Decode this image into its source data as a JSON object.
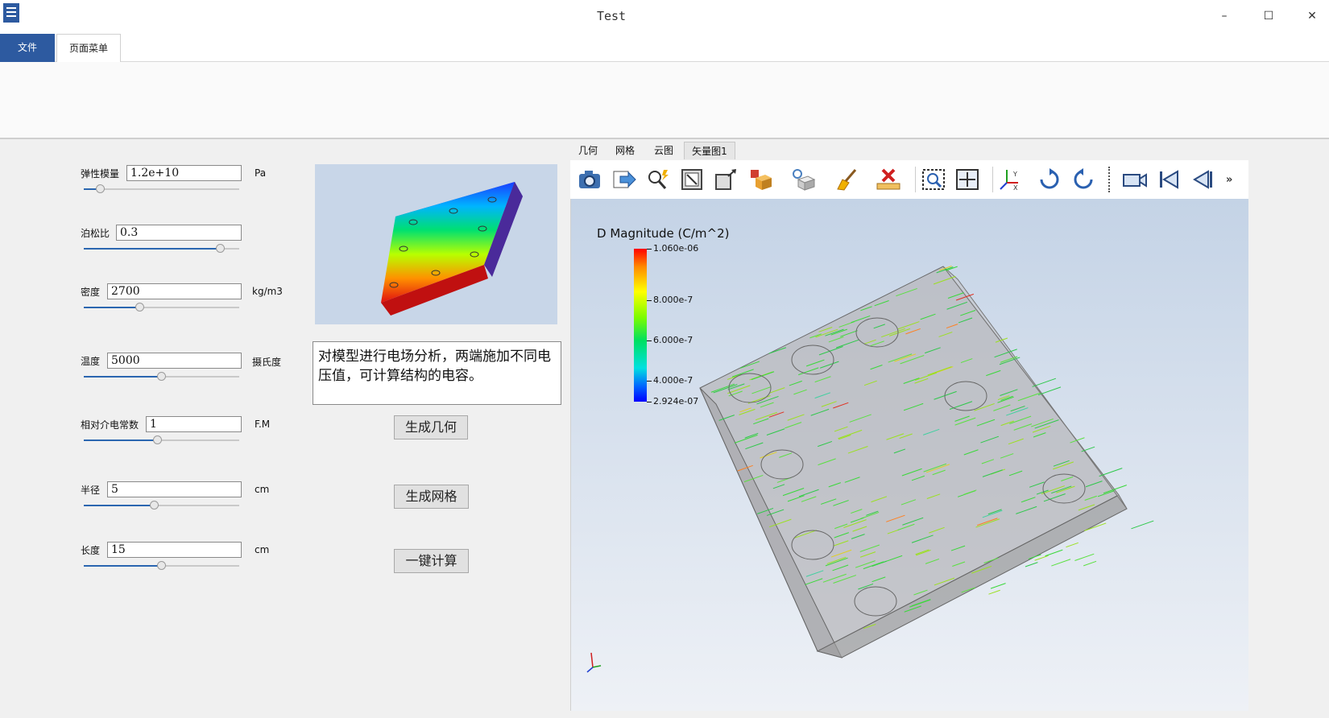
{
  "window": {
    "title": "Test",
    "minimize": "–",
    "maximize": "☐",
    "close": "✕"
  },
  "menu_tabs": {
    "file": "文件",
    "page_menu": "页面菜单"
  },
  "params": [
    {
      "label": "弹性模量",
      "value": "1.2e+10",
      "unit": "Pa",
      "level": 0.08
    },
    {
      "label": "泊松比",
      "value": "0.3",
      "unit": "",
      "level": 0.9
    },
    {
      "label": "密度",
      "value": "2700",
      "unit": "kg/m3",
      "level": 0.35
    },
    {
      "label": "温度",
      "value": "5000",
      "unit": "摄氏度",
      "level": 0.5
    },
    {
      "label": "相对介电常数",
      "value": "1",
      "unit": "F.M",
      "level": 0.47
    },
    {
      "label": "半径",
      "value": "5",
      "unit": "cm",
      "level": 0.45
    },
    {
      "label": "长度",
      "value": "15",
      "unit": "cm",
      "level": 0.5
    }
  ],
  "description": "对模型进行电场分析，两端施加不同电压值，可计算结构的电容。",
  "actions": {
    "gen_geometry": "生成几何",
    "gen_mesh": "生成网格",
    "compute": "一键计算"
  },
  "viewer_tabs": [
    "几何",
    "网格",
    "云图",
    "矢量图1"
  ],
  "toolbar_icons": [
    "camera-icon",
    "export-icon",
    "zoom-pick-icon",
    "frame-icon",
    "box-arrow-icon",
    "shape-layers-icon",
    "light-cube-icon",
    "broom-icon",
    "ruler-delete-icon",
    "zoom-box-icon",
    "fit-view-icon",
    "axes-icon",
    "rotate-cw-icon",
    "rotate-ccw-icon",
    "video-camera-icon",
    "first-frame-icon",
    "prev-frame-icon",
    "more-icon"
  ],
  "legend": {
    "title": "D Magnitude (C/m^2)",
    "labels": [
      "1.060e-06",
      "8.000e-7",
      "6.000e-7",
      "4.000e-7",
      "2.924e-07"
    ]
  },
  "colors": {
    "accent": "#2d5aa0",
    "slider_fill": "#2b66b0"
  }
}
